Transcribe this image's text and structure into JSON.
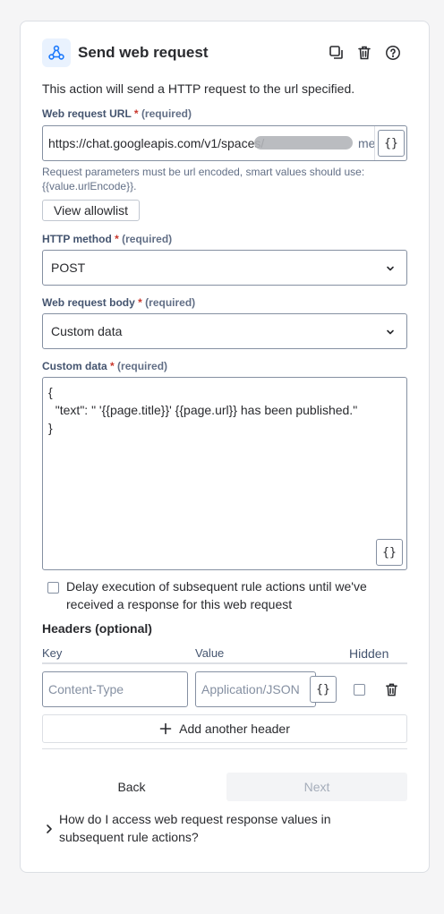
{
  "header": {
    "title": "Send web request",
    "icons": [
      "webhook-icon",
      "duplicate-icon",
      "trash-icon",
      "help-icon"
    ],
    "accent": "#e9f2fe"
  },
  "description": "This action will send a HTTP request to the url specified.",
  "url_field": {
    "label": "Web request URL",
    "required_mark": "*",
    "required_hint": "(required)",
    "value": "https://chat.googleapis.com/v1/spaces/",
    "value_tail": "me",
    "smart_button": "{}"
  },
  "url_help": "Request parameters must be url encoded, smart values should use: {{value.urlEncode}}.",
  "allowlist_button": "View allowlist",
  "method_field": {
    "label": "HTTP method",
    "required_mark": "*",
    "required_hint": "(required)",
    "value": "POST"
  },
  "body_field": {
    "label": "Web request body",
    "required_mark": "*",
    "required_hint": "(required)",
    "value": "Custom data"
  },
  "custom_data": {
    "label": "Custom data",
    "required_mark": "*",
    "required_hint": "(required)",
    "line1": "{",
    "line2": "  \"text\": \" '{{page.title}}' {{page.url}} has been published.\"",
    "line3": "}",
    "smart_button": "{}"
  },
  "delay_checkbox": {
    "checked": false,
    "label": "Delay execution of subsequent rule actions until we've received a response for this web request"
  },
  "headers": {
    "title": "Headers (optional)",
    "col_key": "Key",
    "col_value": "Value",
    "col_hidden": "Hidden",
    "row": {
      "key_placeholder": "Content-Type",
      "value_placeholder": "Application/JSON",
      "smart_button": "{}",
      "hidden": false
    },
    "add_button": "Add another header"
  },
  "footer": {
    "back": "Back",
    "next": "Next"
  },
  "faq": "How do I access web request response values in subsequent rule actions?",
  "colors": {
    "required": "#c9372c",
    "border": "#8590a2",
    "disabled_bg": "#f3f4f6"
  }
}
